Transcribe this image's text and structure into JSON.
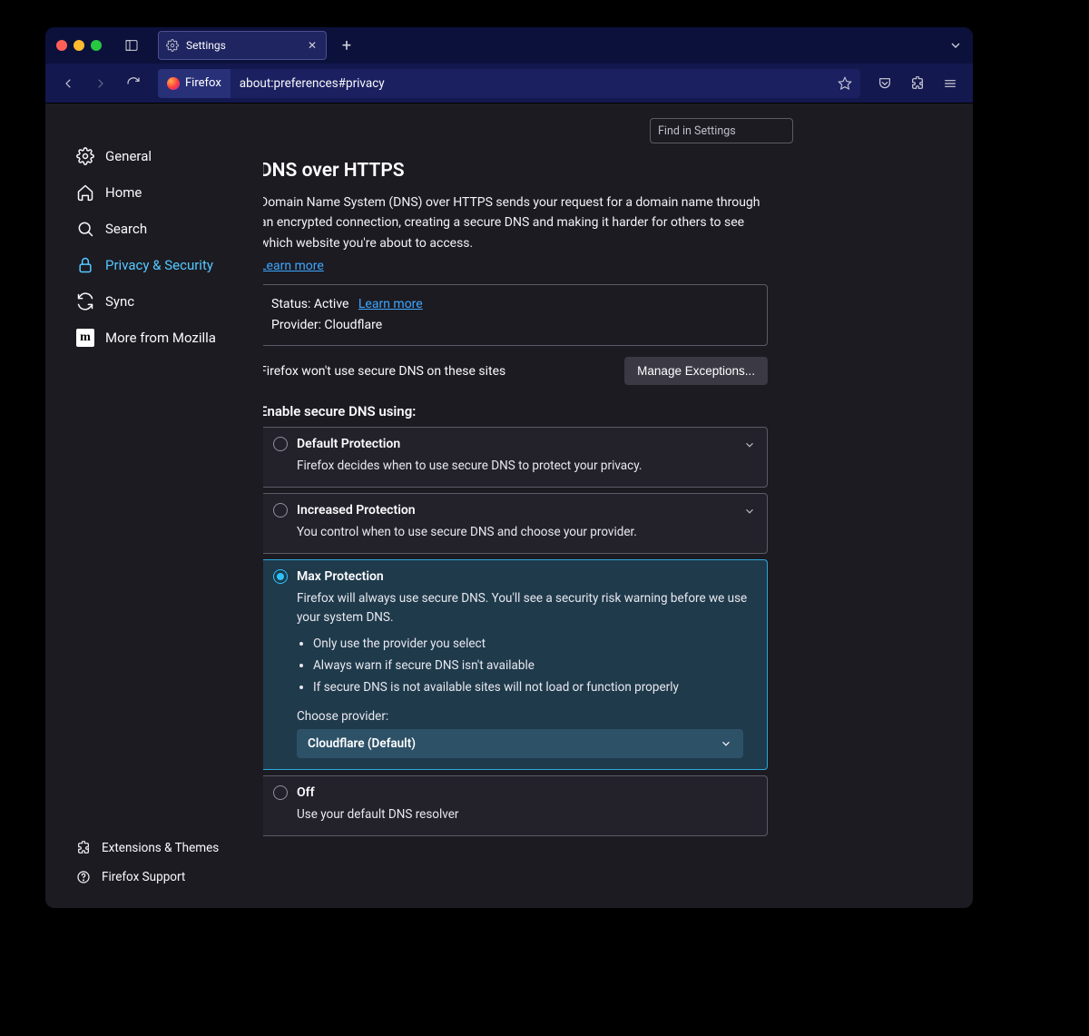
{
  "tab": {
    "title": "Settings"
  },
  "urlbar": {
    "badge": "Firefox",
    "url": "about:preferences#privacy"
  },
  "search": {
    "placeholder": "Find in Settings"
  },
  "sidebar": {
    "items": [
      {
        "label": "General"
      },
      {
        "label": "Home"
      },
      {
        "label": "Search"
      },
      {
        "label": "Privacy & Security"
      },
      {
        "label": "Sync"
      },
      {
        "label": "More from Mozilla"
      }
    ],
    "bottom": [
      {
        "label": "Extensions & Themes"
      },
      {
        "label": "Firefox Support"
      }
    ]
  },
  "page": {
    "heading": "DNS over HTTPS",
    "intro": "Domain Name System (DNS) over HTTPS sends your request for a domain name through an encrypted connection, creating a secure DNS and making it harder for others to see which website you're about to access.",
    "learn_more": "Learn more",
    "status": {
      "status_label": "Status: Active",
      "learn_more": "Learn more",
      "provider": "Provider: Cloudflare"
    },
    "exceptions_text": "Firefox won't use secure DNS on these sites",
    "manage_button": "Manage Exceptions...",
    "enable_heading": "Enable secure DNS using:",
    "options": {
      "default": {
        "title": "Default Protection",
        "sub": "Firefox decides when to use secure DNS to protect your privacy."
      },
      "increased": {
        "title": "Increased Protection",
        "sub": "You control when to use secure DNS and choose your provider."
      },
      "max": {
        "title": "Max Protection",
        "sub": "Firefox will always use secure DNS. You'll see a security risk warning before we use your system DNS.",
        "bullets": [
          "Only use the provider you select",
          "Always warn if secure DNS isn't available",
          "If secure DNS is not available sites will not load or function properly"
        ],
        "choose_label": "Choose provider:",
        "provider": "Cloudflare (Default)"
      },
      "off": {
        "title": "Off",
        "sub": "Use your default DNS resolver"
      }
    }
  }
}
